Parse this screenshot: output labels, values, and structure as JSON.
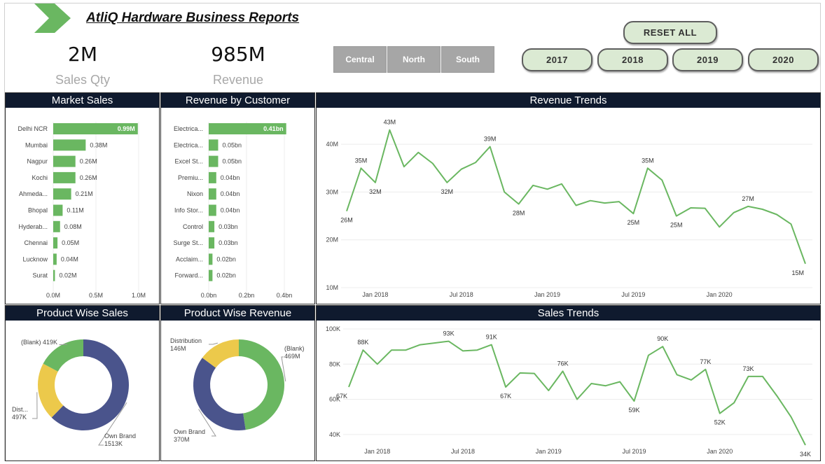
{
  "header": {
    "title": "AtliQ Hardware Business Reports"
  },
  "kpis": [
    {
      "value": "2M",
      "label": "Sales Qty"
    },
    {
      "value": "985M",
      "label": "Revenue"
    }
  ],
  "filters": {
    "regions": [
      "Central",
      "North",
      "South"
    ],
    "reset_label": "RESET ALL",
    "years": [
      "2017",
      "2018",
      "2019",
      "2020"
    ]
  },
  "colors": {
    "green": "#6ab761",
    "navy": "#4a548c",
    "yellow": "#ecc94b",
    "header_bg": "#0f1a2e"
  },
  "panels": {
    "market_sales": "Market Sales",
    "revenue_by_customer": "Revenue by Customer",
    "revenue_trends": "Revenue Trends",
    "product_wise_sales": "Product Wise Sales",
    "product_wise_revenue": "Product Wise Revenue",
    "sales_trends": "Sales Trends"
  },
  "chart_data": [
    {
      "id": "market_sales",
      "type": "bar",
      "orientation": "horizontal",
      "title": "Market Sales",
      "categories": [
        "Delhi NCR",
        "Mumbai",
        "Nagpur",
        "Kochi",
        "Ahmeda...",
        "Bhopal",
        "Hyderab...",
        "Chennai",
        "Lucknow",
        "Surat"
      ],
      "values": [
        0.99,
        0.38,
        0.26,
        0.26,
        0.21,
        0.11,
        0.08,
        0.05,
        0.04,
        0.02
      ],
      "labels": [
        "0.99M",
        "0.38M",
        "0.26M",
        "0.26M",
        "0.21M",
        "0.11M",
        "0.08M",
        "0.05M",
        "0.04M",
        "0.02M"
      ],
      "xlim": [
        0,
        1.0
      ],
      "ticks": [
        "0.0M",
        "0.5M",
        "1.0M"
      ]
    },
    {
      "id": "revenue_by_customer",
      "type": "bar",
      "orientation": "horizontal",
      "title": "Revenue by Customer",
      "categories": [
        "Electrica...",
        "Electrica...",
        "Excel St...",
        "Premiu...",
        "Nixon",
        "Info Stor...",
        "Control",
        "Surge St...",
        "Acclaim...",
        "Forward..."
      ],
      "values": [
        0.41,
        0.05,
        0.05,
        0.04,
        0.04,
        0.04,
        0.03,
        0.03,
        0.02,
        0.02
      ],
      "labels": [
        "0.41bn",
        "0.05bn",
        "0.05bn",
        "0.04bn",
        "0.04bn",
        "0.04bn",
        "0.03bn",
        "0.03bn",
        "0.02bn",
        "0.02bn"
      ],
      "xlim": [
        0,
        0.4
      ],
      "ticks": [
        "0.0bn",
        "0.2bn",
        "0.4bn"
      ]
    },
    {
      "id": "revenue_trends",
      "type": "line",
      "title": "Revenue Trends",
      "ylim": [
        10,
        45
      ],
      "yticks": [
        10,
        20,
        30,
        40
      ],
      "ytick_labels": [
        "10M",
        "20M",
        "30M",
        "40M"
      ],
      "xticks": [
        "Jan 2018",
        "Jul 2018",
        "Jan 2019",
        "Jul 2019",
        "Jan 2020"
      ],
      "xtick_index": [
        2,
        8,
        14,
        20,
        26
      ],
      "values": [
        26,
        35,
        32,
        43,
        35.3,
        38.3,
        36,
        32,
        34.8,
        36.2,
        39.5,
        30,
        27.5,
        31.4,
        30.6,
        31.7,
        27.2,
        28.2,
        27.7,
        28,
        25.5,
        35,
        32.5,
        25,
        26.7,
        26.6,
        22.7,
        25.7,
        27,
        26.4,
        25.3,
        23.3,
        15
      ],
      "point_labels": [
        {
          "i": 0,
          "t": "26M",
          "pos": "below"
        },
        {
          "i": 1,
          "t": "35M",
          "pos": "above"
        },
        {
          "i": 2,
          "t": "32M",
          "pos": "below"
        },
        {
          "i": 3,
          "t": "43M",
          "pos": "above"
        },
        {
          "i": 7,
          "t": "32M",
          "pos": "below"
        },
        {
          "i": 10,
          "t": "39M",
          "pos": "above"
        },
        {
          "i": 12,
          "t": "28M",
          "pos": "below"
        },
        {
          "i": 20,
          "t": "25M",
          "pos": "below"
        },
        {
          "i": 21,
          "t": "35M",
          "pos": "above"
        },
        {
          "i": 23,
          "t": "25M",
          "pos": "below"
        },
        {
          "i": 28,
          "t": "27M",
          "pos": "above"
        },
        {
          "i": 32,
          "t": "15M",
          "pos": "right"
        }
      ]
    },
    {
      "id": "sales_trends",
      "type": "line",
      "title": "Sales Trends",
      "ylim": [
        34,
        100
      ],
      "yticks": [
        40,
        60,
        80,
        100
      ],
      "ytick_labels": [
        "40K",
        "60K",
        "80K",
        "100K"
      ],
      "xticks": [
        "Jan 2018",
        "Jul 2018",
        "Jan 2019",
        "Jul 2019",
        "Jan 2020"
      ],
      "xtick_index": [
        2,
        8,
        14,
        20,
        26
      ],
      "values": [
        67,
        88,
        80,
        88,
        88,
        91,
        92,
        93,
        87.5,
        88,
        91,
        67,
        75,
        74.7,
        65,
        76,
        60,
        69,
        67.7,
        70,
        59,
        85,
        90,
        74,
        71,
        77,
        52,
        58,
        73,
        73,
        62,
        50,
        34
      ],
      "point_labels": [
        {
          "i": 0,
          "t": "67K",
          "pos": "right"
        },
        {
          "i": 1,
          "t": "88K",
          "pos": "above"
        },
        {
          "i": 7,
          "t": "93K",
          "pos": "above"
        },
        {
          "i": 10,
          "t": "91K",
          "pos": "above"
        },
        {
          "i": 11,
          "t": "67K",
          "pos": "below"
        },
        {
          "i": 15,
          "t": "76K",
          "pos": "above"
        },
        {
          "i": 20,
          "t": "59K",
          "pos": "below"
        },
        {
          "i": 22,
          "t": "90K",
          "pos": "above"
        },
        {
          "i": 25,
          "t": "77K",
          "pos": "above"
        },
        {
          "i": 26,
          "t": "52K",
          "pos": "below"
        },
        {
          "i": 28,
          "t": "73K",
          "pos": "above"
        },
        {
          "i": 32,
          "t": "34K",
          "pos": "below"
        }
      ]
    },
    {
      "id": "product_wise_sales",
      "type": "pie",
      "donut": true,
      "title": "Product Wise Sales",
      "slices": [
        {
          "name": "Own Brand",
          "value": 1513,
          "label": "Own Brand\n1513K",
          "color": "#4a548c"
        },
        {
          "name": "Dist...",
          "value": 497,
          "label": "Dist...\n497K",
          "color": "#ecc94b"
        },
        {
          "name": "(Blank)",
          "value": 419,
          "label": "(Blank) 419K",
          "color": "#6ab761"
        }
      ]
    },
    {
      "id": "product_wise_revenue",
      "type": "pie",
      "donut": true,
      "title": "Product Wise Revenue",
      "slices": [
        {
          "name": "(Blank)",
          "value": 469,
          "label": "(Blank)\n469M",
          "color": "#6ab761"
        },
        {
          "name": "Own Brand",
          "value": 370,
          "label": "Own Brand\n370M",
          "color": "#4a548c"
        },
        {
          "name": "Distribution",
          "value": 146,
          "label": "Distribution\n146M",
          "color": "#ecc94b"
        }
      ]
    }
  ]
}
